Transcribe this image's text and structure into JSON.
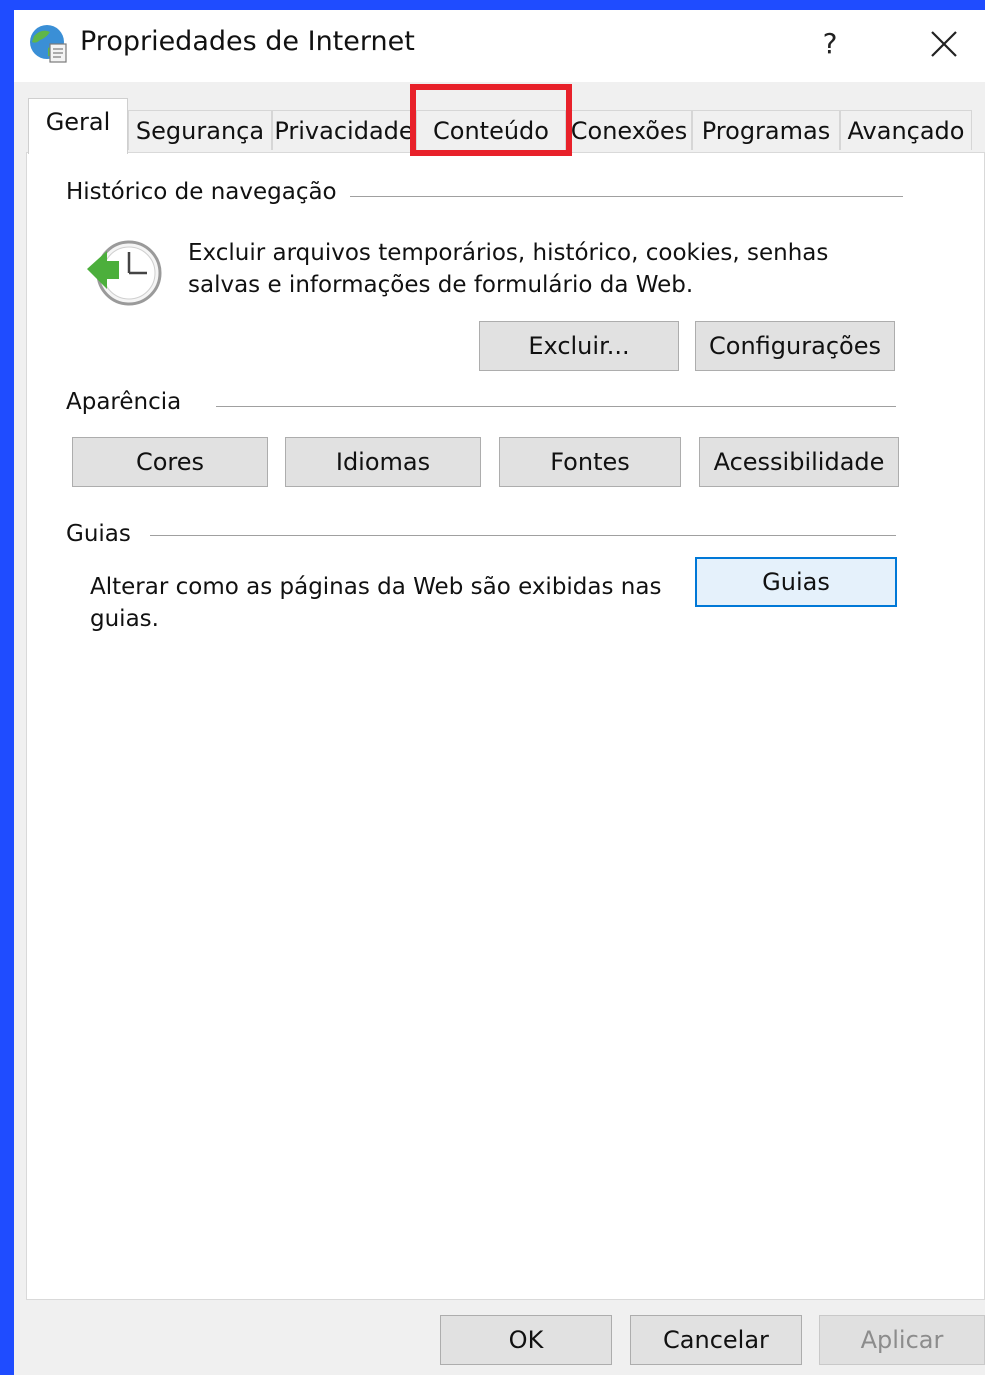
{
  "window": {
    "title": "Propriedades de Internet",
    "help_label": "?"
  },
  "tabs": [
    {
      "label": "Geral",
      "active": true
    },
    {
      "label": "Segurança"
    },
    {
      "label": "Privacidade"
    },
    {
      "label": "Conteúdo",
      "highlighted": true
    },
    {
      "label": "Conexões"
    },
    {
      "label": "Programas"
    },
    {
      "label": "Avançado"
    }
  ],
  "history": {
    "heading": "Histórico de navegação",
    "description_line1": "Excluir arquivos temporários, histórico, cookies, senhas",
    "description_line2": "salvas e informações de formulário da Web.",
    "delete_label": "Excluir...",
    "settings_label": "Configurações"
  },
  "appearance": {
    "heading": "Aparência",
    "buttons": [
      "Cores",
      "Idiomas",
      "Fontes",
      "Acessibilidade"
    ]
  },
  "tabs_group": {
    "heading": "Guias",
    "description_line1": "Alterar como as páginas da Web são exibidas nas",
    "description_line2": "guias.",
    "button_label": "Guias"
  },
  "footer": {
    "ok_label": "OK",
    "cancel_label": "Cancelar",
    "apply_label": "Aplicar"
  },
  "colors": {
    "desktop_background": "#1f4cff",
    "highlight_box": "#e8212a",
    "focus_border": "#0078d7"
  }
}
